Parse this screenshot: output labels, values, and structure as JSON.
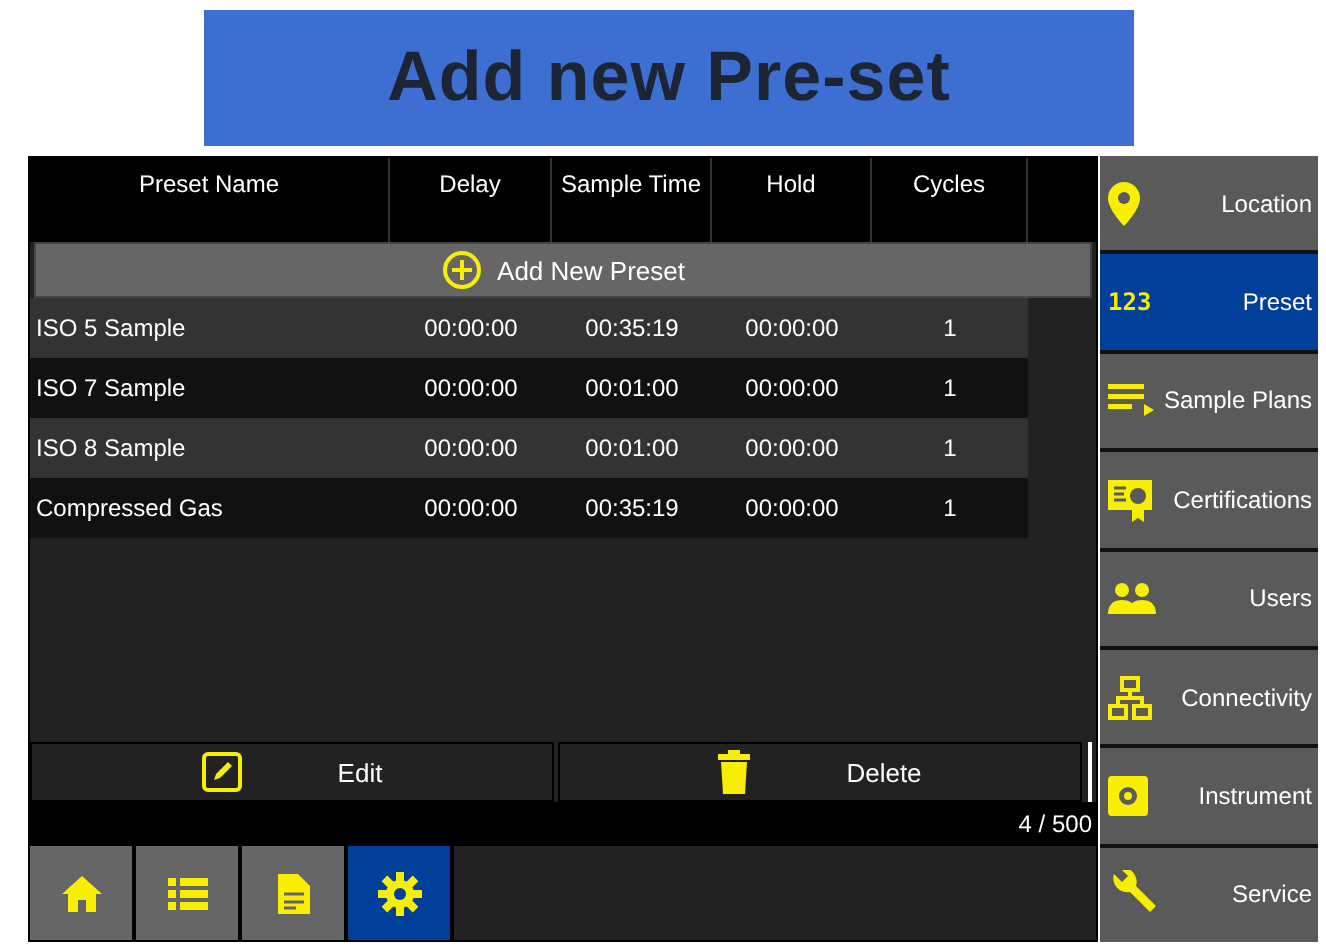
{
  "banner": {
    "title": "Add new Pre-set"
  },
  "table": {
    "columns": [
      "Preset Name",
      "Delay",
      "Sample Time",
      "Hold",
      "Cycles"
    ],
    "add_button": "Add New Preset",
    "rows": [
      {
        "cells": [
          "ISO 5 Sample",
          "00:00:00",
          "00:35:19",
          "00:00:00",
          "1"
        ]
      },
      {
        "cells": [
          "ISO 7 Sample",
          "00:00:00",
          "00:01:00",
          "00:00:00",
          "1"
        ]
      },
      {
        "cells": [
          "ISO 8 Sample",
          "00:00:00",
          "00:01:00",
          "00:00:00",
          "1"
        ]
      },
      {
        "cells": [
          "Compressed Gas",
          "00:00:00",
          "00:35:19",
          "00:00:00",
          "1"
        ]
      }
    ]
  },
  "actions": [
    {
      "label": "Edit"
    },
    {
      "label": "Delete"
    }
  ],
  "count": "4 / 500",
  "bottom_nav": [
    {
      "selected": false
    },
    {
      "selected": false
    },
    {
      "selected": false
    },
    {
      "selected": true
    }
  ],
  "sidebar": {
    "items": [
      {
        "label": "Location",
        "selected": false
      },
      {
        "label": "Preset",
        "icon_text": "123",
        "selected": true
      },
      {
        "label": "Sample Plans",
        "selected": false
      },
      {
        "label": "Certifications",
        "selected": false
      },
      {
        "label": "Users",
        "selected": false
      },
      {
        "label": "Connectivity",
        "selected": false
      },
      {
        "label": "Instrument",
        "selected": false
      },
      {
        "label": "Service",
        "selected": false
      }
    ]
  }
}
